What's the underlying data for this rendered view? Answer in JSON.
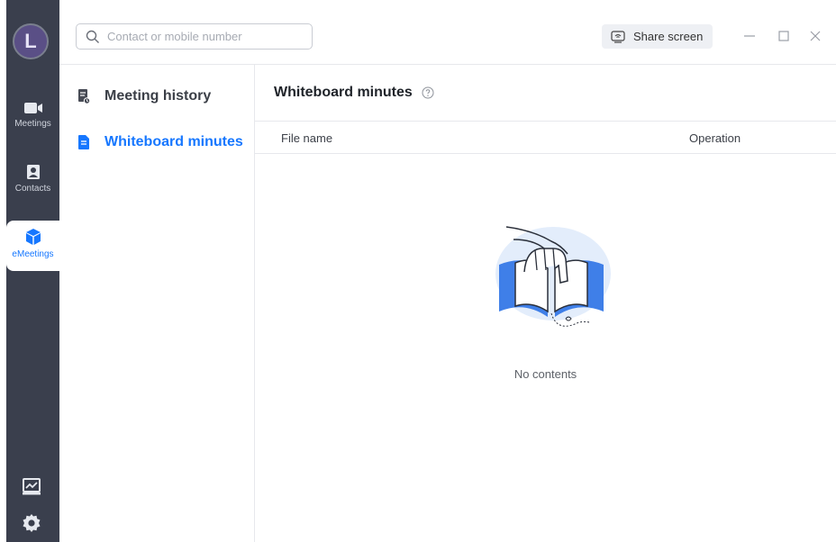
{
  "app": {
    "avatar_initial": "L"
  },
  "rail": {
    "items": [
      {
        "label": "Meetings"
      },
      {
        "label": "Contacts"
      },
      {
        "label": "eMeetings"
      }
    ]
  },
  "topbar": {
    "search_placeholder": "Contact or mobile number",
    "share_label": "Share screen"
  },
  "subnav": {
    "items": [
      {
        "label": "Meeting history"
      },
      {
        "label": "Whiteboard minutes"
      }
    ]
  },
  "main": {
    "title": "Whiteboard minutes",
    "columns": [
      "File name",
      "Operation"
    ],
    "empty_text": "No contents"
  },
  "colors": {
    "accent": "#1677ff",
    "rail_bg": "#3a3f4d"
  }
}
